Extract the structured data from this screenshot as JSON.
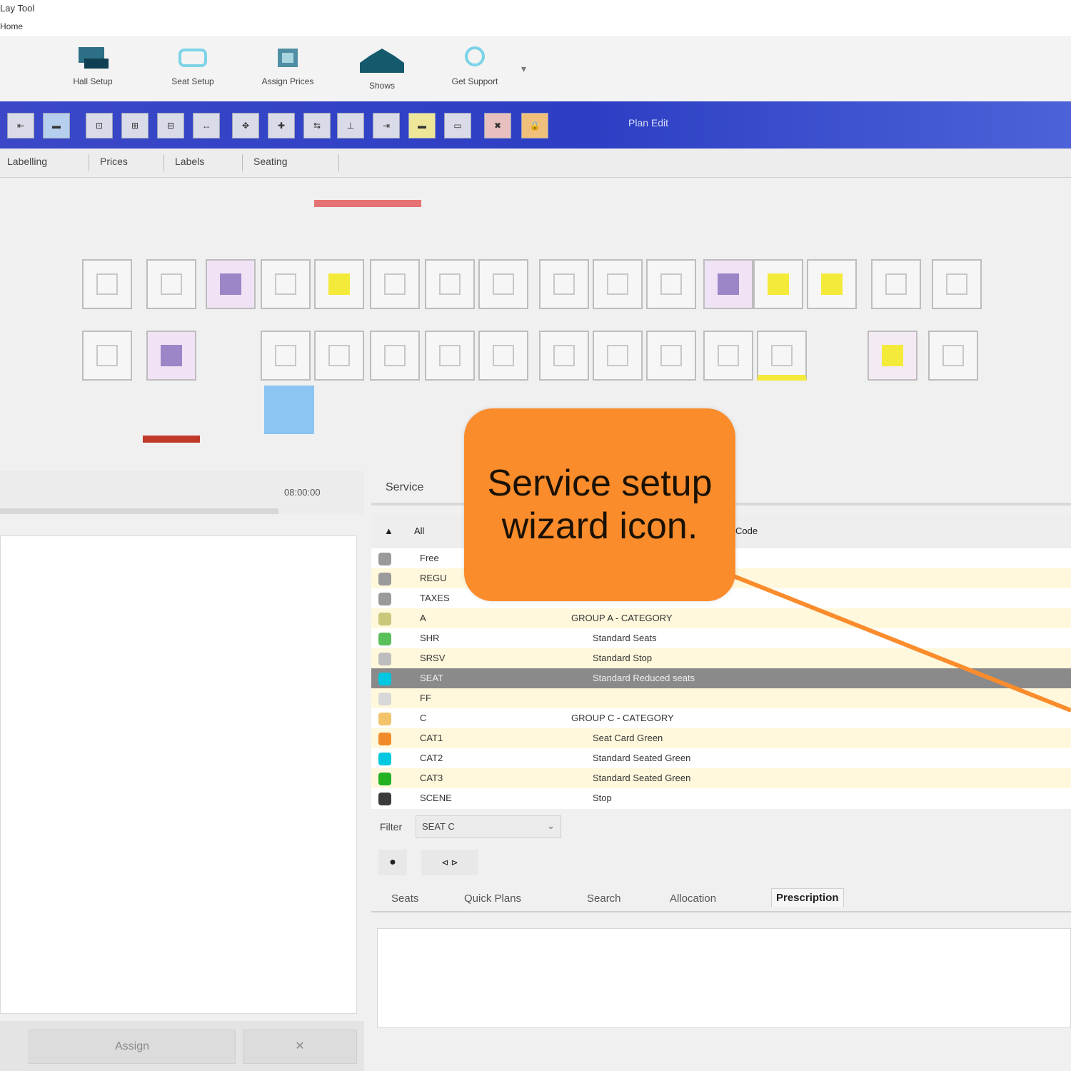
{
  "titlebar": {
    "title": "Lay Tool",
    "menu": "Home"
  },
  "ribbon": {
    "buttons": [
      {
        "label": "Hall Setup",
        "icon": "hall-setup-icon"
      },
      {
        "label": "Seat Setup",
        "icon": "seat-setup-icon"
      },
      {
        "label": "Assign Prices",
        "icon": "assign-prices-icon"
      },
      {
        "label": "Shows",
        "icon": "shows-icon"
      },
      {
        "label": "Get Support",
        "icon": "support-icon"
      }
    ]
  },
  "bluebar": {
    "label": "Plan Edit"
  },
  "tabs": [
    "Labelling",
    "Prices",
    "Labels",
    "Seating"
  ],
  "left_panel": {
    "time": "08:00:00",
    "bottom_button": "Assign"
  },
  "right_panel": {
    "tab_title": "Service",
    "header_col1": "All",
    "header_col2": "Code",
    "rows": [
      {
        "code": "Free",
        "desc": "",
        "color": "#9a9a9a"
      },
      {
        "code": "REGU",
        "desc": "",
        "color": "#9a9a9a"
      },
      {
        "code": "TAXES",
        "desc": "",
        "color": "#9a9a9a"
      },
      {
        "code": "A",
        "desc": "GROUP A - CATEGORY",
        "color": "#c8c77a"
      },
      {
        "code": "SHR",
        "desc": "Standard Seats",
        "color": "#5ac05a"
      },
      {
        "code": "SRSV",
        "desc": "Standard Stop",
        "color": "#bdbdbd"
      },
      {
        "code": "SEAT",
        "desc": "Standard Reduced seats",
        "color": "#00c8e0"
      },
      {
        "code": "FF",
        "desc": "",
        "color": "#d8d8d8"
      },
      {
        "code": "C",
        "desc": "GROUP C - CATEGORY",
        "color": "#f2c36a"
      },
      {
        "code": "CAT1",
        "desc": "Seat Card Green",
        "color": "#f08a2a"
      },
      {
        "code": "CAT2",
        "desc": "Standard Seated Green",
        "color": "#00c8e0"
      },
      {
        "code": "CAT3",
        "desc": "Standard Seated Green",
        "color": "#22b222"
      },
      {
        "code": "SCENE",
        "desc": "Stop",
        "color": "#3a3a3a"
      }
    ],
    "filter_label": "Filter",
    "filter_value": "SEAT C",
    "subtabs": [
      "Seats",
      "Quick Plans",
      "Search",
      "Allocation",
      "Prescription"
    ],
    "active_subtab": "Prescription"
  },
  "callout": {
    "text": "Service setup wizard icon."
  }
}
